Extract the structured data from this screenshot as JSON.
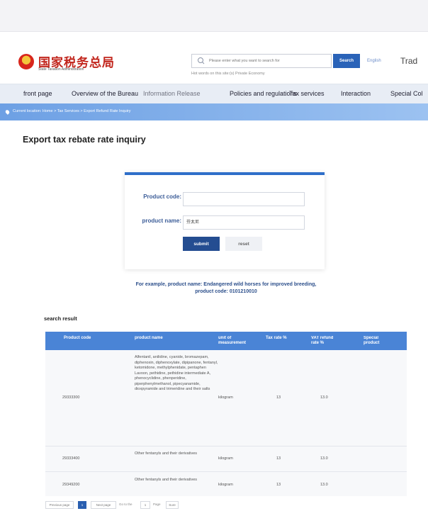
{
  "header": {
    "logo_cn": "国家税务总局",
    "logo_en": "State Taxation Administration",
    "search_placeholder": "Please enter what you want to search for",
    "search_button": "Search",
    "hot_words": "Hot words on this site:(s) Private Economy",
    "lang_english": "English",
    "lang_trad": "Trad"
  },
  "nav": {
    "items": [
      "front page",
      "Overview of the Bureau",
      "Information Release",
      "Policies and regulations",
      "Tax services",
      "Interaction",
      "Special Col"
    ]
  },
  "breadcrumb": "Current location: Home > Tax Services > Export Refund Rate Inquiry",
  "page_title": "Export tax rebate rate inquiry",
  "form": {
    "product_code_label": "Product code:",
    "product_name_label": "product name:",
    "product_code_value": "",
    "product_name_value": "芬太尼",
    "submit": "submit",
    "reset": "reset",
    "example": "For example, product name: Endangered wild horses for improved breeding, product code: 0101210010"
  },
  "results": {
    "title": "search result",
    "columns": [
      "Product code",
      "product name",
      "unit of measurement",
      "Tax rate %",
      "VAT refund rate %",
      "Special product"
    ],
    "rows": [
      {
        "code": "29333300",
        "name": "Alfentanil, anilidine, cyanide, bromazepam, diphenoxin, diphenoxylate, dipipanone, fentanyl, ketomidone, methylphenidate, pentaphen Lavoon, pethidine, pethidine intermediate A, phenocyclidine, phenperidine, piperphenylmethanol, pipecyanamide, dioxpyramide and trimeridine and their salts",
        "unit": "kilogram",
        "tax": "13",
        "vat": "13.0",
        "special": ""
      },
      {
        "code": "29333400",
        "name": "Other fentanyls and their derivatives",
        "unit": "kilogram",
        "tax": "13",
        "vat": "13.0",
        "special": ""
      },
      {
        "code": "29349200",
        "name": "Other fentanyls and their derivatives",
        "unit": "kilogram",
        "tax": "13",
        "vat": "13.0",
        "special": ""
      }
    ]
  },
  "pagination": {
    "prev": "Previous page",
    "current": "1",
    "next": "Next page",
    "goto": "Go to the",
    "page_input": "1",
    "page_suffix": "Page",
    "ok": "Sure"
  },
  "colors": {
    "primary": "#2a63b8",
    "table_header": "#4a84d6",
    "breadcrumb_bar": "#6da0e4",
    "logo_red": "#c2271e"
  }
}
